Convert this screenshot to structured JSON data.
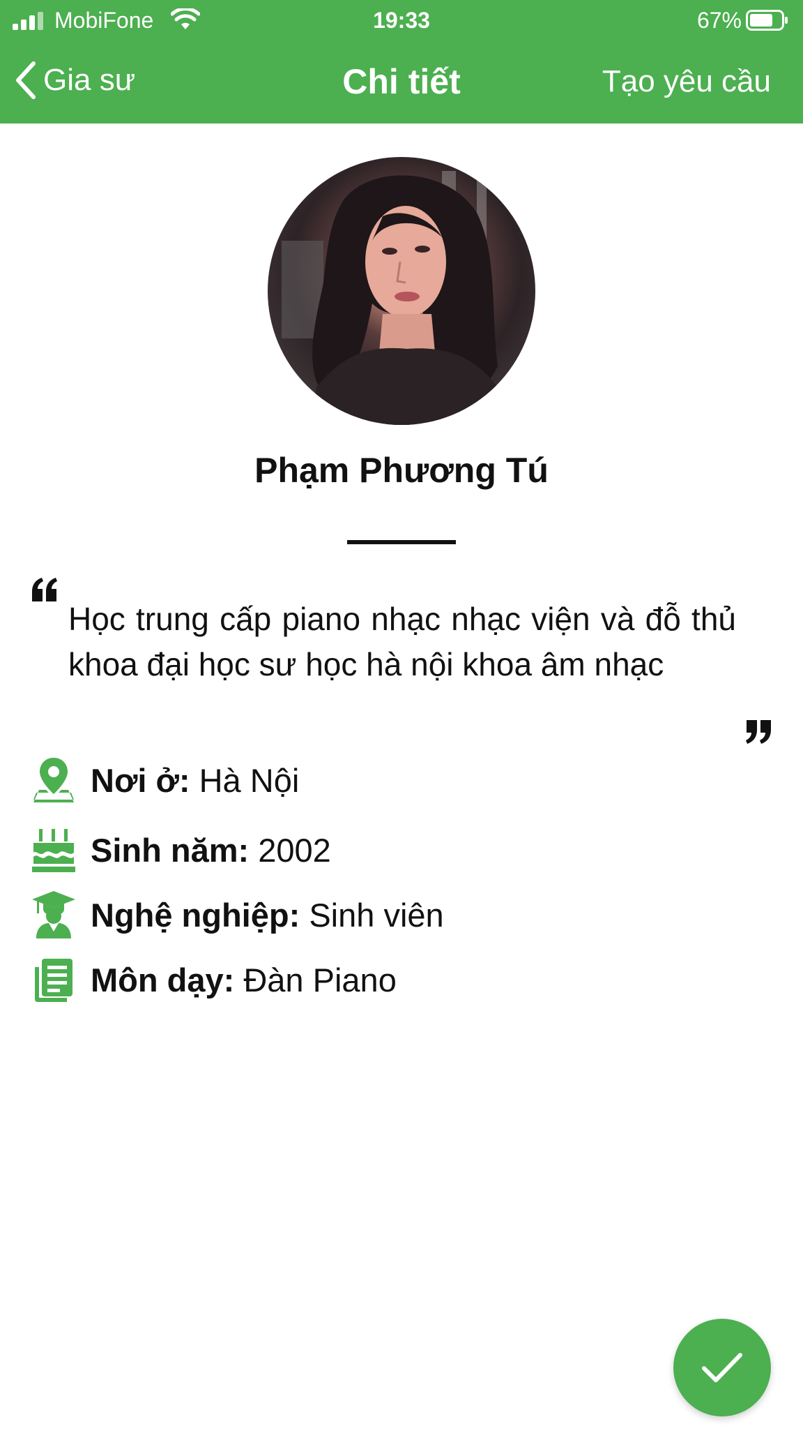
{
  "status_bar": {
    "carrier": "MobiFone",
    "time": "19:33",
    "battery": "67%"
  },
  "nav": {
    "back_label": "Gia sư",
    "title": "Chi tiết",
    "action_label": "Tạo yêu cầu"
  },
  "profile": {
    "name": "Phạm Phương Tú",
    "bio": "Học trung cấp piano nhạc nhạc viện và đỗ thủ khoa đại học sư học hà nội khoa âm nhạc"
  },
  "details": [
    {
      "icon": "location-pin-icon",
      "label": "Nơi ở:",
      "value": "Hà Nội"
    },
    {
      "icon": "birthday-cake-icon",
      "label": "Sinh năm:",
      "value": "2002"
    },
    {
      "icon": "graduate-icon",
      "label": "Nghệ nghiệp:",
      "value": "Sinh viên"
    },
    {
      "icon": "subject-book-icon",
      "label": "Môn dạy:",
      "value": "Đàn Piano"
    }
  ],
  "colors": {
    "primary": "#4caf50",
    "text": "#111111",
    "background": "#ffffff"
  }
}
